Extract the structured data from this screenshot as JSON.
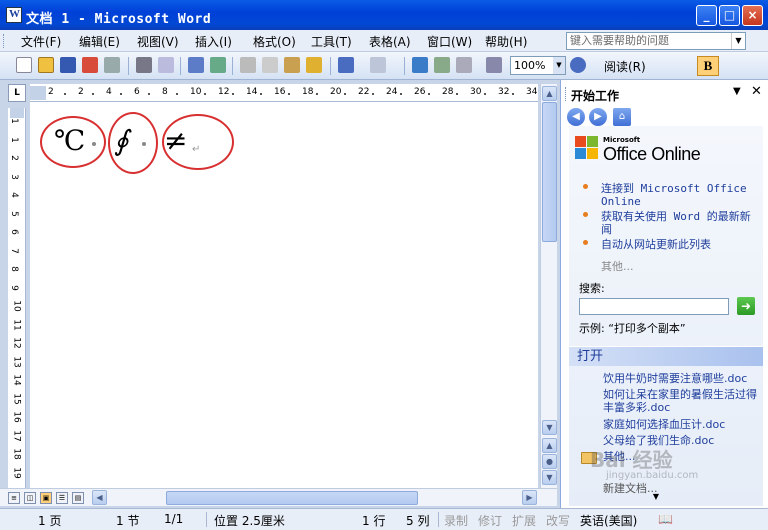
{
  "window": {
    "title": "文档 1 - Microsoft Word",
    "minimize": "_",
    "maximize": "□",
    "close": "×"
  },
  "menu": {
    "items": [
      "文件(F)",
      "编辑(E)",
      "视图(V)",
      "插入(I)",
      "格式(O)",
      "工具(T)",
      "表格(A)",
      "窗口(W)",
      "帮助(H)"
    ],
    "help_placeholder": "键入需要帮助的问题"
  },
  "toolbar": {
    "zoom": "100%",
    "read_label": "阅读(R)",
    "bold_label": "B"
  },
  "ruler": {
    "corner": "L",
    "h_ticks": [
      "2",
      "2",
      "4",
      "6",
      "8",
      "10",
      "12",
      "14",
      "16",
      "18",
      "20",
      "22",
      "24",
      "26",
      "28",
      "30",
      "32",
      "34"
    ],
    "v_ticks": [
      "1",
      "1",
      "2",
      "3",
      "4",
      "5",
      "6",
      "7",
      "8",
      "9",
      "10",
      "11",
      "12",
      "13",
      "14",
      "15",
      "16",
      "17",
      "18",
      "19"
    ]
  },
  "document": {
    "symbols": [
      "℃",
      "∮",
      "≠"
    ],
    "para_mark": "↵"
  },
  "taskpane": {
    "title": "开始工作",
    "office_ms": "Microsoft",
    "office_brand": "Office Online",
    "links": [
      "连接到 Microsoft Office Online",
      "获取有关使用 Word 的最新新闻",
      "自动从网站更新此列表"
    ],
    "more": "其他...",
    "search_label": "搜索:",
    "example": "示例: “打印多个副本”",
    "open_header": "打开",
    "recent_docs": [
      "饮用牛奶时需要注意哪些.doc",
      "如何让呆在家里的暑假生活过得丰富多彩.doc",
      "家庭如何选择血压计.doc",
      "父母给了我们生命.doc"
    ],
    "open_more": "其他...",
    "new_doc": "新建文档..."
  },
  "status": {
    "page": "1 页",
    "section": "1 节",
    "pages": "1/1",
    "position": "位置 2.5厘米",
    "line": "1 行",
    "col": "5 列",
    "rec": "录制",
    "trk": "修订",
    "ext": "扩展",
    "ovr": "改写",
    "lang": "英语(美国)"
  },
  "watermark": {
    "text": "Bai 经验",
    "url": "jingyan.baidu.com"
  }
}
